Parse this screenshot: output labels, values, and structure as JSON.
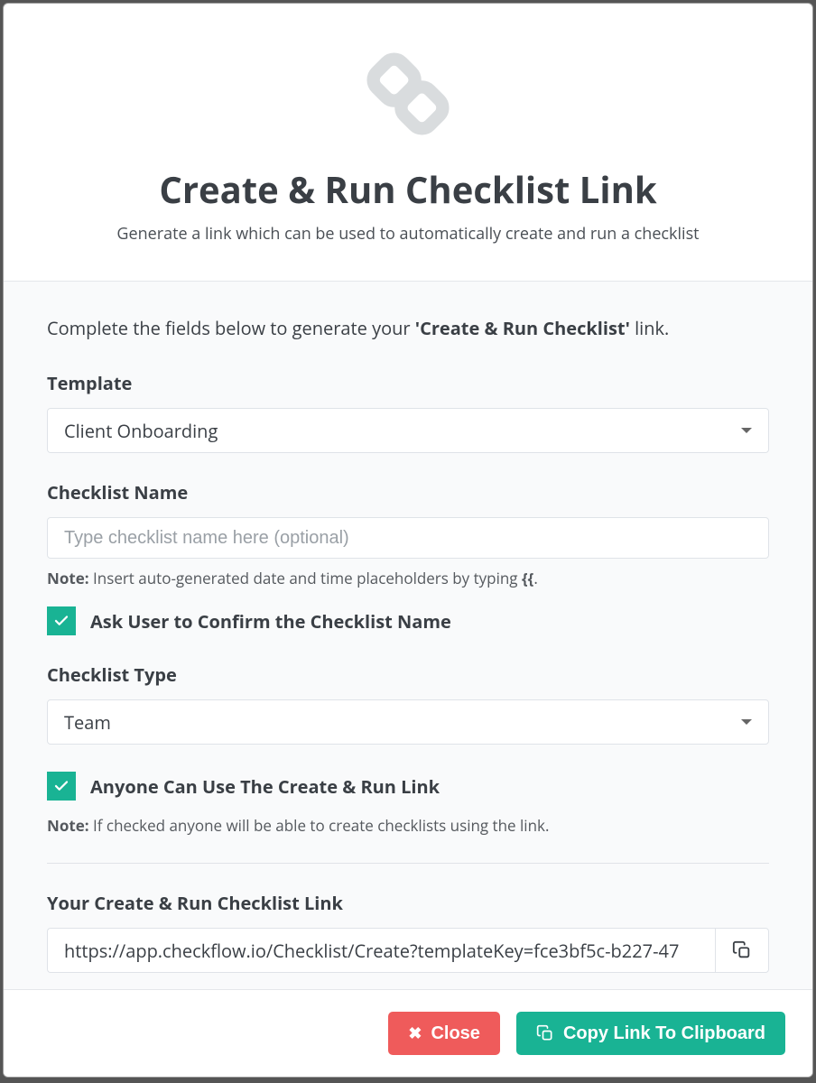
{
  "header": {
    "title": "Create & Run Checklist Link",
    "subtitle": "Generate a link which can be used to automatically create and run a checklist"
  },
  "intro": {
    "prefix": "Complete the fields below to generate your ",
    "bold": "'Create & Run Checklist'",
    "suffix": " link."
  },
  "template": {
    "label": "Template",
    "value": "Client Onboarding"
  },
  "checklistName": {
    "label": "Checklist Name",
    "placeholder": "Type checklist name here (optional)",
    "note_bold": "Note:",
    "note_text": " Insert auto-generated date and time placeholders by typing ",
    "note_code": "{{",
    "note_after": "."
  },
  "confirmName": {
    "label": "Ask User to Confirm the Checklist Name",
    "checked": true
  },
  "checklistType": {
    "label": "Checklist Type",
    "value": "Team"
  },
  "anyone": {
    "label": "Anyone Can Use The Create & Run Link",
    "checked": true,
    "note_bold": "Note:",
    "note_text": " If checked anyone will be able to create checklists using the link."
  },
  "linkSection": {
    "label": "Your Create & Run Checklist Link",
    "value": "https://app.checkflow.io/Checklist/Create?templateKey=fce3bf5c-b227-47"
  },
  "footer": {
    "close": "Close",
    "copy": "Copy Link To Clipboard"
  }
}
